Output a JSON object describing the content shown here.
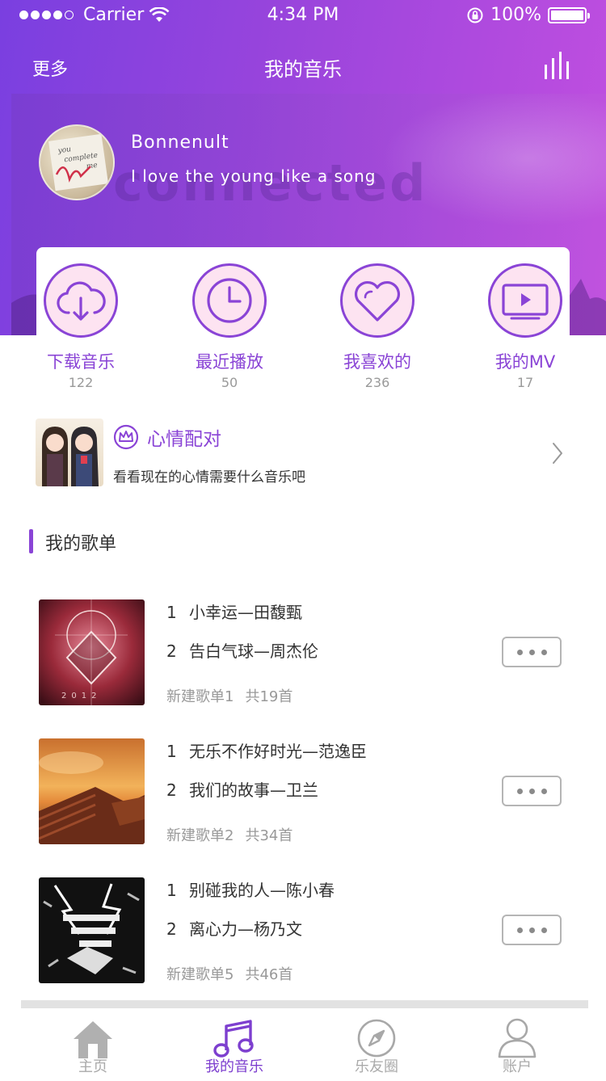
{
  "status_bar": {
    "carrier": "Carrier",
    "time": "4:34 PM",
    "battery": "100%"
  },
  "nav": {
    "left_label": "更多",
    "title": "我的音乐",
    "right_icon": "equalizer-icon"
  },
  "profile": {
    "name": "Bonnenult",
    "signature": "I love the young like a song",
    "banner_watermark": "connected"
  },
  "quick_actions": [
    {
      "label": "下载音乐",
      "count": "122",
      "icon": "cloud-download-icon"
    },
    {
      "label": "最近播放",
      "count": "50",
      "icon": "clock-icon"
    },
    {
      "label": "我喜欢的",
      "count": "236",
      "icon": "heart-icon"
    },
    {
      "label": "我的MV",
      "count": "17",
      "icon": "video-play-icon"
    }
  ],
  "mood": {
    "title": "心情配对",
    "subtitle": "看看现在的心情需要什么音乐吧",
    "icon": "crown-icon"
  },
  "section": {
    "title": "我的歌单"
  },
  "playlists": [
    {
      "songs": [
        {
          "num": "1",
          "title": "小幸运—田馥甄"
        },
        {
          "num": "2",
          "title": "告白气球—周杰伦"
        }
      ],
      "name": "新建歌单1",
      "count": "共19首"
    },
    {
      "songs": [
        {
          "num": "1",
          "title": "无乐不作好时光—范逸臣"
        },
        {
          "num": "2",
          "title": "我们的故事—卫兰"
        }
      ],
      "name": "新建歌单2",
      "count": "共34首"
    },
    {
      "songs": [
        {
          "num": "1",
          "title": "别碰我的人—陈小春"
        },
        {
          "num": "2",
          "title": "离心力—杨乃文"
        }
      ],
      "name": "新建歌单5",
      "count": "共46首"
    }
  ],
  "tabbar": [
    {
      "label": "主页",
      "icon": "home-icon",
      "active": false
    },
    {
      "label": "我的音乐",
      "icon": "music-note-icon",
      "active": true
    },
    {
      "label": "乐友圈",
      "icon": "compass-icon",
      "active": false
    },
    {
      "label": "账户",
      "icon": "user-icon",
      "active": false
    }
  ],
  "colors": {
    "accent": "#8a44d6",
    "header_start": "#7a3fe0",
    "header_end": "#c24fe0",
    "icon_fill": "#fde3f1",
    "muted_text": "#999999"
  }
}
